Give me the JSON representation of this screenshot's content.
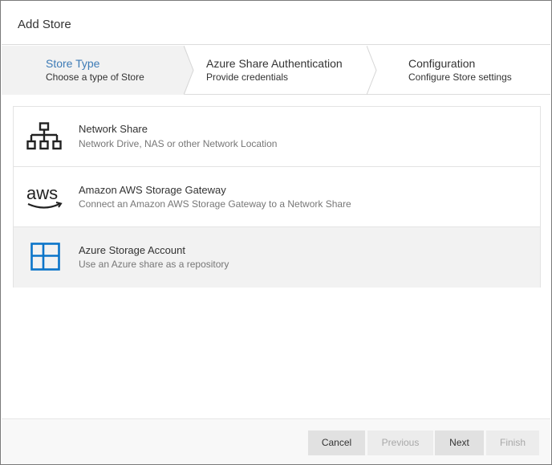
{
  "dialog": {
    "title": "Add Store"
  },
  "steps": [
    {
      "title": "Store Type",
      "subtitle": "Choose a type of Store",
      "active": true
    },
    {
      "title": "Azure Share Authentication",
      "subtitle": "Provide credentials",
      "active": false
    },
    {
      "title": "Configuration",
      "subtitle": "Configure Store settings",
      "active": false
    }
  ],
  "options": [
    {
      "icon": "network-share-icon",
      "title": "Network Share",
      "description": "Network Drive, NAS or other Network Location",
      "selected": false
    },
    {
      "icon": "aws-logo-icon",
      "logo_text": "aws",
      "title": "Amazon AWS Storage Gateway",
      "description": "Connect an Amazon AWS Storage Gateway to a Network Share",
      "selected": false
    },
    {
      "icon": "windows-azure-icon",
      "title": "Azure Storage Account",
      "description": "Use an Azure share as a repository",
      "selected": true
    }
  ],
  "footer": {
    "cancel": "Cancel",
    "previous": "Previous",
    "next": "Next",
    "finish": "Finish"
  },
  "colors": {
    "accent": "#3d7bb6",
    "azure_blue": "#0a74c9",
    "selected_row": "#f2f2f2"
  }
}
